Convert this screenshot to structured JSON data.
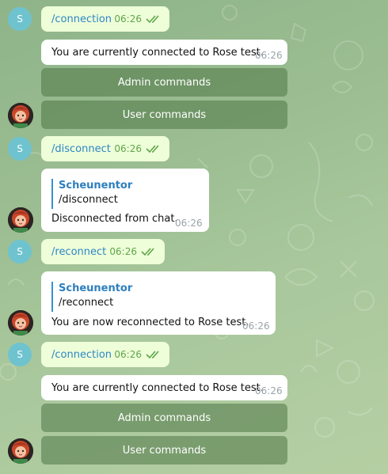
{
  "user_avatar": {
    "letter": "S",
    "color": "#6ec3cf"
  },
  "bot": {
    "name": "Scheunentor"
  },
  "messages": [
    {
      "command": "/connection",
      "time": "06:26"
    },
    {
      "text": "You are currently connected to Rose test.",
      "time": "06:26",
      "buttons": [
        "Admin commands",
        "User commands"
      ]
    },
    {
      "command": "/disconnect",
      "time": "06:26"
    },
    {
      "reply_sender": "Scheunentor",
      "reply_text": "/disconnect",
      "text": "Disconnected from chat.",
      "time": "06:26"
    },
    {
      "command": "/reconnect",
      "time": "06:26"
    },
    {
      "reply_sender": "Scheunentor",
      "reply_text": "/reconnect",
      "text": "You are now reconnected to Rose test.",
      "time": "06:26"
    },
    {
      "command": "/connection",
      "time": "06:26"
    },
    {
      "text": "You are currently connected to Rose test.",
      "time": "06:26",
      "buttons": [
        "Admin commands",
        "User commands"
      ]
    }
  ],
  "colors": {
    "outgoing_bubble": "#eefed8",
    "incoming_bubble": "#ffffff",
    "link": "#2d86c7",
    "tick": "#5ea64b",
    "keyboard_button": "#4e7646"
  }
}
